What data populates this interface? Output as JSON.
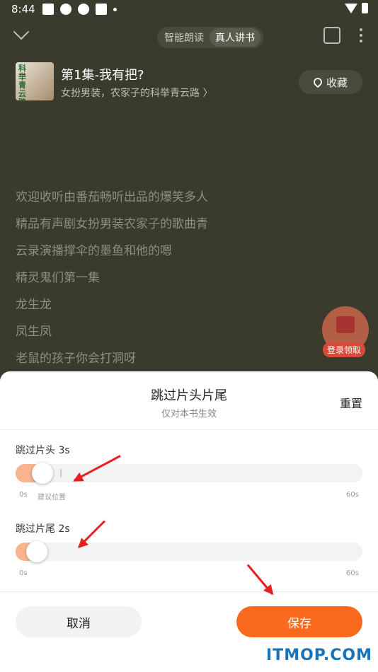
{
  "status_bar": {
    "time": "8:44"
  },
  "header": {
    "modes": [
      "智能朗读",
      "真人讲书"
    ],
    "active_mode": "真人讲书"
  },
  "book": {
    "cover_text": "科举青云路",
    "episode_title": "第1集-我有把?",
    "book_name": "女扮男装，农家子的科举青云路 〉",
    "favorite_label": "收藏"
  },
  "lyrics": [
    "欢迎收听由番茄畅听出品的爆笑多人",
    "精品有声剧女扮男装农家子的歌曲青",
    "云录演播撑伞的墨鱼和他的嗯",
    "精灵鬼们第一集",
    "龙生龙",
    "凤生凤",
    "老鼠的孩子你会打洞呀"
  ],
  "promo": {
    "label": "登录领取"
  },
  "sheet": {
    "title": "跳过片头片尾",
    "subtitle": "仅对本书生效",
    "reset_label": "重置",
    "intro": {
      "label": "跳过片头 3s",
      "value_seconds": 3,
      "max_seconds": 60,
      "min_label": "0s",
      "max_label": "60s",
      "suggest_label": "建议位置"
    },
    "outro": {
      "label": "跳过片尾 2s",
      "value_seconds": 2,
      "max_seconds": 60,
      "min_label": "0s",
      "max_label": "60s"
    },
    "cancel_label": "取消",
    "save_label": "保存"
  },
  "colors": {
    "accent": "#fa6a1e",
    "slider_fill": "#f9b48f",
    "annotation_arrow": "#e62020"
  },
  "watermark": "ITMOP.COM"
}
